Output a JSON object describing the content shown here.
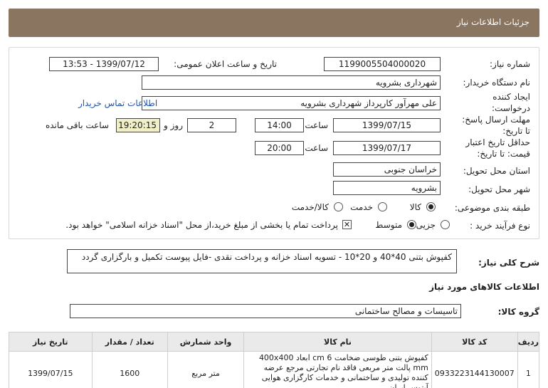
{
  "header": {
    "title": "جزئیات اطلاعات نیاز"
  },
  "form": {
    "need_number_label": "شماره نیاز:",
    "need_number": "1199005504000020",
    "announce_label": "تاریخ و ساعت اعلان عمومی:",
    "announce_value": "1399/07/12 - 13:53",
    "buyer_org_label": "نام دستگاه خریدار:",
    "buyer_org": "شهرداری بشرویه",
    "creator_label_1": "ایجاد کننده",
    "creator_label_2": "درخواست:",
    "creator": "علی مهرآور کارپرداز شهرداری بشرویه",
    "contact_link": "اطلاعات تماس خریدار",
    "deadline_label_1": "مهلت ارسال پاسخ:",
    "deadline_label_2": "تا تاریخ:",
    "deadline_date": "1399/07/15",
    "time_label": "ساعت",
    "deadline_time": "14:00",
    "days_value": "2",
    "days_label": "روز و",
    "remaining_time": "19:20:15",
    "remaining_label": "ساعت باقی مانده",
    "validity_label_1": "حداقل تاریخ اعتبار",
    "validity_label_2": "قیمت: تا تاریخ:",
    "validity_date": "1399/07/17",
    "validity_time_label": "ساعت",
    "validity_time": "20:00",
    "province_label": "استان محل تحویل:",
    "province": "خراسان جنوبی",
    "city_label": "شهر محل تحویل:",
    "city": "بشرویه",
    "category_label": "طبقه بندی موضوعی:",
    "category_options": [
      "کالا",
      "خدمت",
      "کالا/خدمت"
    ],
    "process_label": "نوع فرآیند خرید :",
    "process_options": [
      "جزیی",
      "متوسط"
    ],
    "payment_note": "پرداخت تمام یا بخشی از مبلغ خرید،از محل \"اسناد خزانه اسلامی\" خواهد بود."
  },
  "description": {
    "label": "شرح کلی نیاز:",
    "text": "کفپوش بتنی 40*40 و 20*10 - تسویه اسناد خزانه و پرداخت نقدی -فایل پیوست تکمیل و بارگزاری گردد"
  },
  "goods": {
    "section_title": "اطلاعات کالاهای مورد نیاز",
    "group_label": "گروه کالا:",
    "group_value": "تاسیسات و مصالح ساختمانی",
    "columns": [
      "ردیف",
      "کد کالا",
      "نام کالا",
      "واحد شمارش",
      "تعداد / مقدار",
      "تاریخ نیاز"
    ],
    "rows": [
      {
        "index": "1",
        "code": "0933223144130007",
        "name": "کفپوش بتنی طوسی ضخامت 6 cm ابعاد 400x400 mm پالت متر مربعی فاقد نام تجارتی مرجع عرضه کننده تولیدی و ساختمانی و خدمات کارگزاری هوایی آپتوس ایران",
        "unit": "متر مربع",
        "qty": "1600",
        "date": "1399/07/15"
      }
    ]
  }
}
